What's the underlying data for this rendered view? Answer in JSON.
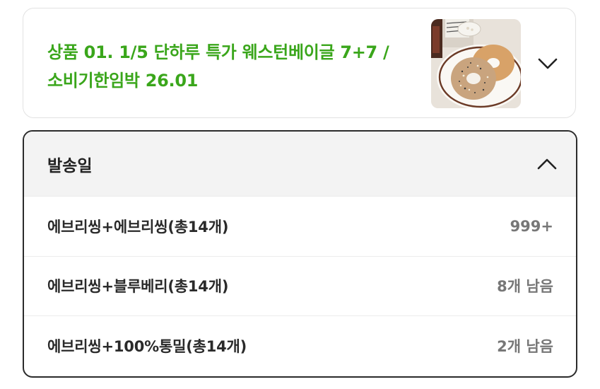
{
  "product": {
    "title_line1": "상품 01. 1/5 단하루 특가 웨스턴베이글 7+7 /",
    "title_line2": "소비기한임박 26.01",
    "image_icon": "bagel-photo",
    "toggle_icon": "chevron-down-icon"
  },
  "options": {
    "header": "발송일",
    "header_icon": "chevron-up-icon",
    "items": [
      {
        "name": "에브리씽+에브리씽(총14개)",
        "stock": "999+"
      },
      {
        "name": "에브리씽+블루베리(총14개)",
        "stock": "8개 남음"
      },
      {
        "name": "에브리씽+100%통밀(총14개)",
        "stock": "2개 남음"
      }
    ]
  },
  "colors": {
    "title_green": "#3aa61b",
    "panel_border": "#2b2b2b",
    "header_bg": "#f3f3f3",
    "stock_text": "#777777"
  }
}
